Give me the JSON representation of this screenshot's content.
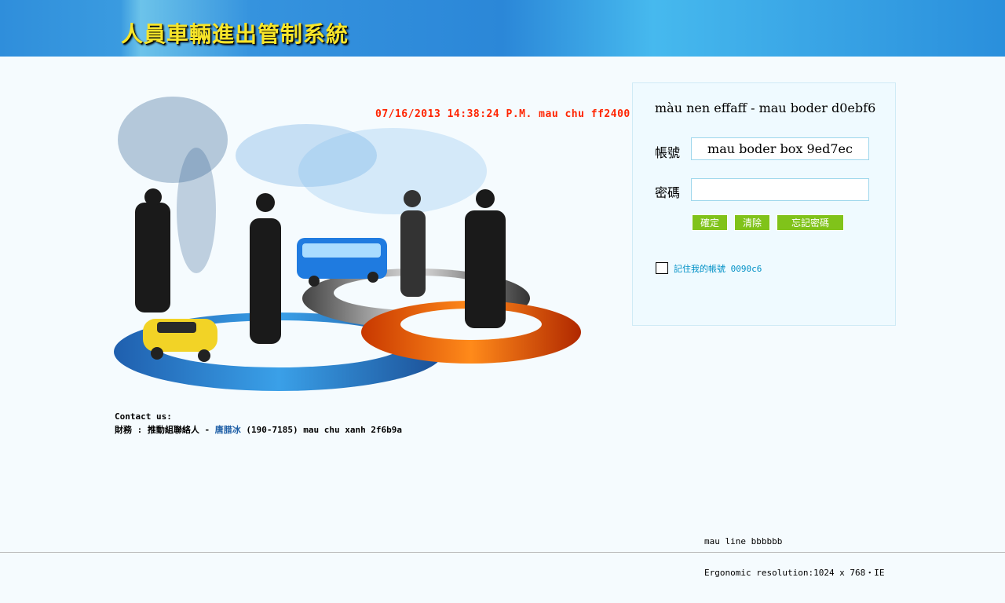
{
  "header": {
    "title": "人員車輛進出管制系統"
  },
  "hero": {
    "timestamp": "07/16/2013 14:38:24 P.M. mau chu ff2400"
  },
  "contact": {
    "heading": "Contact us:",
    "line_prefix": "財務 : 推動組聯絡人 - ",
    "person": "唐腊冰",
    "line_suffix": " (190-7185)  mau chu xanh 2f6b9a"
  },
  "login": {
    "panel_title": "màu nen effaff - mau boder d0ebf6",
    "account_label": "帳號",
    "account_value": "mau boder box 9ed7ec",
    "password_label": "密碼",
    "password_value": "",
    "confirm_button": "確定",
    "clear_button": "清除",
    "forgot_button": "忘記密碼",
    "remember_label": "記住我的帳號 0090c6"
  },
  "footer": {
    "line_note": "mau line bbbbbb",
    "resolution_note": "Ergonomic resolution:1024 x 768・IE"
  },
  "colors": {
    "background": "#f5fbfe",
    "panel_bg": "#effaff",
    "panel_border": "#d0ebf6",
    "input_border": "#9ed7ec",
    "button": "#80c31a",
    "timestamp": "#ff2400",
    "link": "#0090c6",
    "line": "#bbbbbb"
  }
}
